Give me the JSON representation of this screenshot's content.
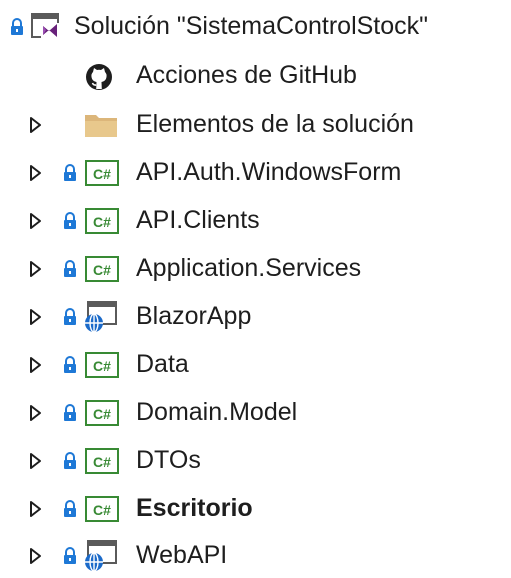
{
  "solution": {
    "label": "Solución \"SistemaControlStock\"",
    "icon": "visual-studio-solution-icon",
    "locked": true
  },
  "items": [
    {
      "label": "Acciones de GitHub",
      "icon": "github-icon",
      "expander": false,
      "locked": false,
      "bold": false
    },
    {
      "label": "Elementos de la solución",
      "icon": "folder-icon",
      "expander": true,
      "locked": false,
      "bold": false
    },
    {
      "label": "API.Auth.WindowsForm",
      "icon": "csharp-project-icon",
      "expander": true,
      "locked": true,
      "bold": false
    },
    {
      "label": "API.Clients",
      "icon": "csharp-project-icon",
      "expander": true,
      "locked": true,
      "bold": false
    },
    {
      "label": "Application.Services",
      "icon": "csharp-project-icon",
      "expander": true,
      "locked": true,
      "bold": false
    },
    {
      "label": "BlazorApp",
      "icon": "web-project-icon",
      "expander": true,
      "locked": true,
      "bold": false
    },
    {
      "label": "Data",
      "icon": "csharp-project-icon",
      "expander": true,
      "locked": true,
      "bold": false
    },
    {
      "label": "Domain.Model",
      "icon": "csharp-project-icon",
      "expander": true,
      "locked": true,
      "bold": false
    },
    {
      "label": "DTOs",
      "icon": "csharp-project-icon",
      "expander": true,
      "locked": true,
      "bold": false
    },
    {
      "label": "Escritorio",
      "icon": "csharp-project-icon",
      "expander": true,
      "locked": true,
      "bold": true
    },
    {
      "label": "WebAPI",
      "icon": "web-project-icon",
      "expander": true,
      "locked": true,
      "bold": false
    }
  ],
  "colors": {
    "lock": "#1e78d6",
    "csharp_green": "#388a34",
    "folder": "#dcb67a",
    "vs_purple": "#68217a",
    "globe": "#1b6ac9",
    "text": "#1e1e1e"
  }
}
